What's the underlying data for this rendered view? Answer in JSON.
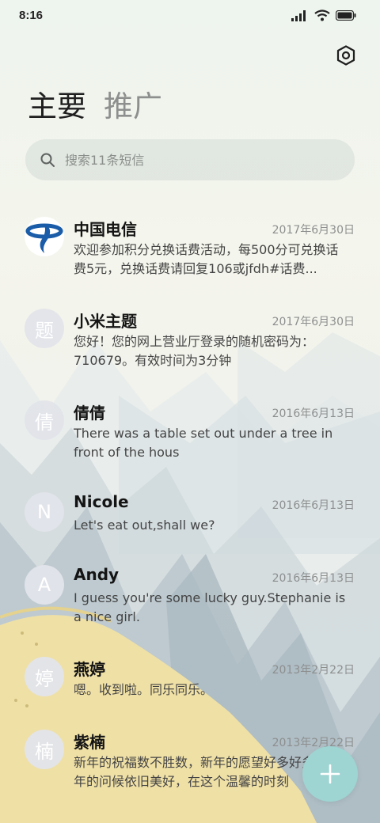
{
  "status_bar": {
    "time": "8:16",
    "icons": [
      "signal-icon",
      "wifi-icon",
      "battery-icon"
    ]
  },
  "header": {
    "settings_icon": "settings-hexagon-icon",
    "tabs": [
      {
        "label": "主要",
        "active": true
      },
      {
        "label": "推广",
        "active": false
      }
    ]
  },
  "search": {
    "placeholder": "搜索11条短信",
    "value": ""
  },
  "messages": [
    {
      "sender": "中国电信",
      "avatar": "china-telecom-logo",
      "date": "2017年6月30日",
      "preview": "欢迎参加积分兑换话费活动，每500分可兑换话费5元，兑换话费请回复106或jfdh#话费..."
    },
    {
      "sender": "小米主题",
      "avatar": "题",
      "date": "2017年6月30日",
      "preview": "您好！您的网上营业厅登录的随机密码为：710679。有效时间为3分钟"
    },
    {
      "sender": "倩倩",
      "avatar": "倩",
      "date": "2016年6月13日",
      "preview": "There was a table set out under a tree in front of the hous"
    },
    {
      "sender": "Nicole",
      "avatar": "N",
      "date": "2016年6月13日",
      "preview": "Let's eat out,shall we?"
    },
    {
      "sender": "Andy",
      "avatar": "A",
      "date": "2016年6月13日",
      "preview": "I guess you're some lucky guy.Stephanie is a nice girl."
    },
    {
      "sender": "燕婷",
      "avatar": "婷",
      "date": "2013年2月22日",
      "preview": "嗯。收到啦。同乐同乐。"
    },
    {
      "sender": "紫楠",
      "avatar": "楠",
      "date": "2013年2月22日",
      "preview": "新年的祝福数不胜数，新年的愿望好多好多，新年的问候依旧美好，在这个温馨的时刻"
    }
  ],
  "fab": {
    "icon": "plus-icon",
    "color": "#9ed4d2"
  },
  "colors": {
    "accent": "#9ed4d2",
    "telecom_blue": "#1a5ca8"
  }
}
